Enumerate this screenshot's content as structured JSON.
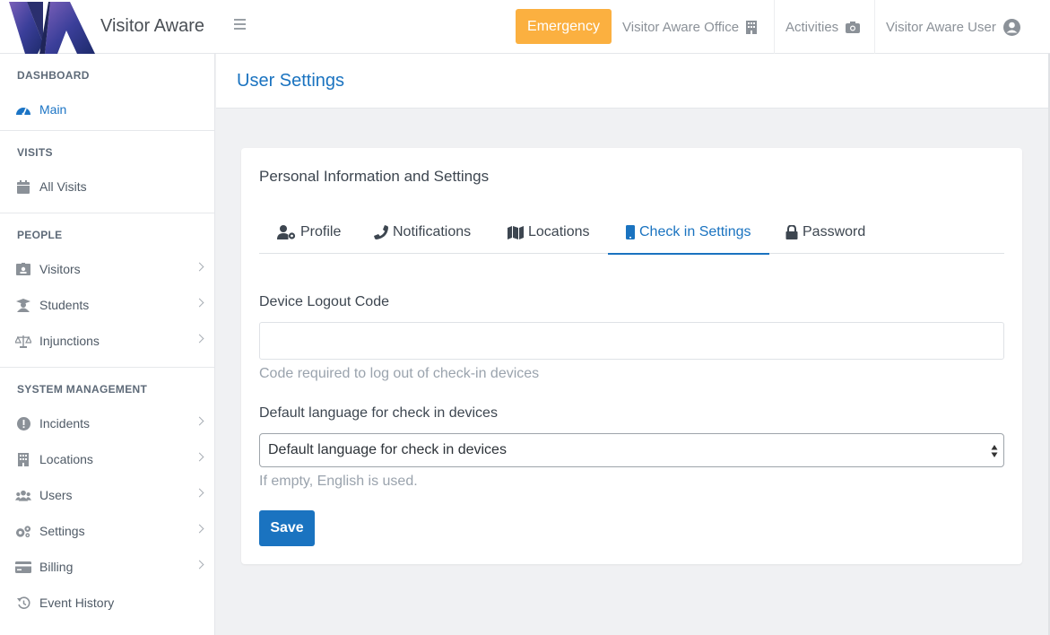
{
  "brand": {
    "name": "Visitor Aware"
  },
  "topbar": {
    "emergency_label": "Emergency",
    "office_label": "Visitor Aware Office",
    "activities_label": "Activities",
    "user_label": "Visitor Aware User"
  },
  "sidebar": {
    "sections": [
      {
        "title": "DASHBOARD",
        "items": [
          {
            "label": "Main",
            "icon": "dashboard-icon",
            "active": true
          }
        ]
      },
      {
        "title": "VISITS",
        "items": [
          {
            "label": "All Visits",
            "icon": "calendar-icon"
          }
        ]
      },
      {
        "title": "PEOPLE",
        "items": [
          {
            "label": "Visitors",
            "icon": "id-badge-icon"
          },
          {
            "label": "Students",
            "icon": "student-icon"
          },
          {
            "label": "Injunctions",
            "icon": "balance-scale-icon"
          }
        ]
      },
      {
        "title": "SYSTEM MANAGEMENT",
        "items": [
          {
            "label": "Incidents",
            "icon": "exclamation-circle-icon"
          },
          {
            "label": "Locations",
            "icon": "building-icon"
          },
          {
            "label": "Users",
            "icon": "users-icon"
          },
          {
            "label": "Settings",
            "icon": "cogs-icon"
          },
          {
            "label": "Billing",
            "icon": "credit-card-icon"
          },
          {
            "label": "Event History",
            "icon": "history-icon"
          }
        ]
      }
    ]
  },
  "page": {
    "title": "User Settings"
  },
  "card": {
    "title": "Personal Information and Settings",
    "tabs": [
      {
        "label": "Profile",
        "icon": "user-cog-icon"
      },
      {
        "label": "Notifications",
        "icon": "phone-icon"
      },
      {
        "label": "Locations",
        "icon": "map-icon"
      },
      {
        "label": "Check in Settings",
        "icon": "mobile-icon",
        "active": true
      },
      {
        "label": "Password",
        "icon": "lock-icon"
      }
    ],
    "logout_code": {
      "label": "Device Logout Code",
      "value": "",
      "help": "Code required to log out of check-in devices"
    },
    "language": {
      "label": "Default language for check in devices",
      "selected": "Default language for check in devices",
      "help": "If empty, English is used."
    },
    "save_label": "Save"
  },
  "colors": {
    "accent": "#1a73c0",
    "emergency": "#fbb040",
    "background": "#f0f1f3"
  }
}
